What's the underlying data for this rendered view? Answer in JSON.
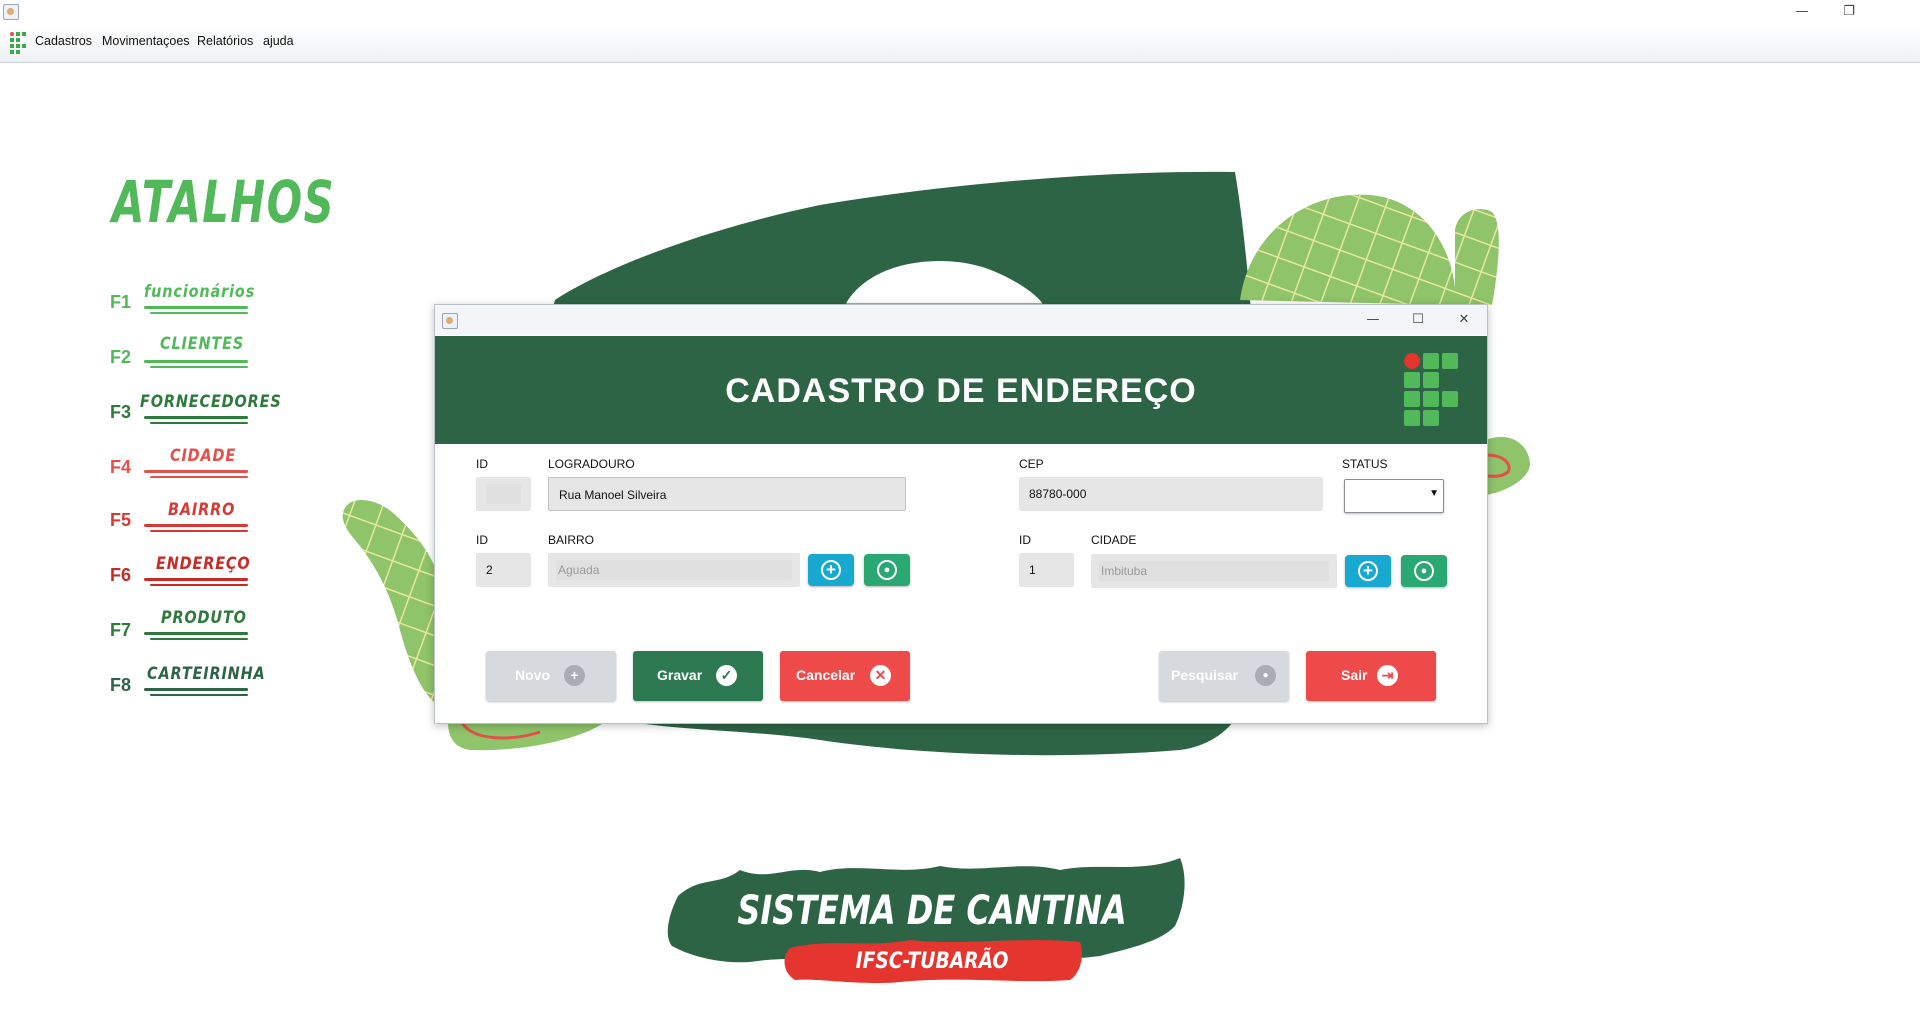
{
  "window": {
    "minimize": "—",
    "restore": "❐",
    "close": ""
  },
  "menubar": {
    "items": [
      "Cadastros",
      "Movimentaçoes",
      "Relatórios",
      "ajuda"
    ]
  },
  "sidebar": {
    "title": "ATALHOS",
    "shortcuts": [
      {
        "key": "F1",
        "label": "funcionários",
        "color": "#52b95a"
      },
      {
        "key": "F2",
        "label": "CLIENTES",
        "color": "#52b95a"
      },
      {
        "key": "F3",
        "label": "FORNECEDORES",
        "color": "#2d7a3c"
      },
      {
        "key": "F4",
        "label": "CIDADE",
        "color": "#e4504a"
      },
      {
        "key": "F5",
        "label": "BAIRRO",
        "color": "#d63a34"
      },
      {
        "key": "F6",
        "label": "ENDEREÇO",
        "color": "#c92a26"
      },
      {
        "key": "F7",
        "label": "PRODUTO",
        "color": "#2d7a3c"
      },
      {
        "key": "F8",
        "label": "CARTEIRINHA",
        "color": "#2d6446"
      }
    ]
  },
  "dialog": {
    "title": "CADASTRO DE ENDEREÇO",
    "minimize": "—",
    "maximize": "☐",
    "close": "✕",
    "labels": {
      "id1": "ID",
      "logradouro": "LOGRADOURO",
      "cep": "CEP",
      "status": "STATUS",
      "id2": "ID",
      "bairro": "BAIRRO",
      "id3": "ID",
      "cidade": "CIDADE"
    },
    "values": {
      "id1": "",
      "logradouro": "Rua Manoel Silveira",
      "cep": "88780-000",
      "status": "",
      "bairro_id": "2",
      "bairro": "Aguada",
      "cidade_id": "1",
      "cidade": "Imbituba"
    },
    "buttons": {
      "novo": "Novo",
      "gravar": "Gravar",
      "cancelar": "Cancelar",
      "pesquisar": "Pesquisar",
      "sair": "Sair"
    }
  },
  "colors": {
    "brand_green": "#2d6446",
    "light_green": "#52b95a",
    "red": "#ef4a4a",
    "cyan": "#17a9cf",
    "teal": "#2aa873"
  },
  "footer": {
    "line1": "SISTEMA DE CANTINA",
    "line2": "IFSC-TUBARÃO"
  }
}
